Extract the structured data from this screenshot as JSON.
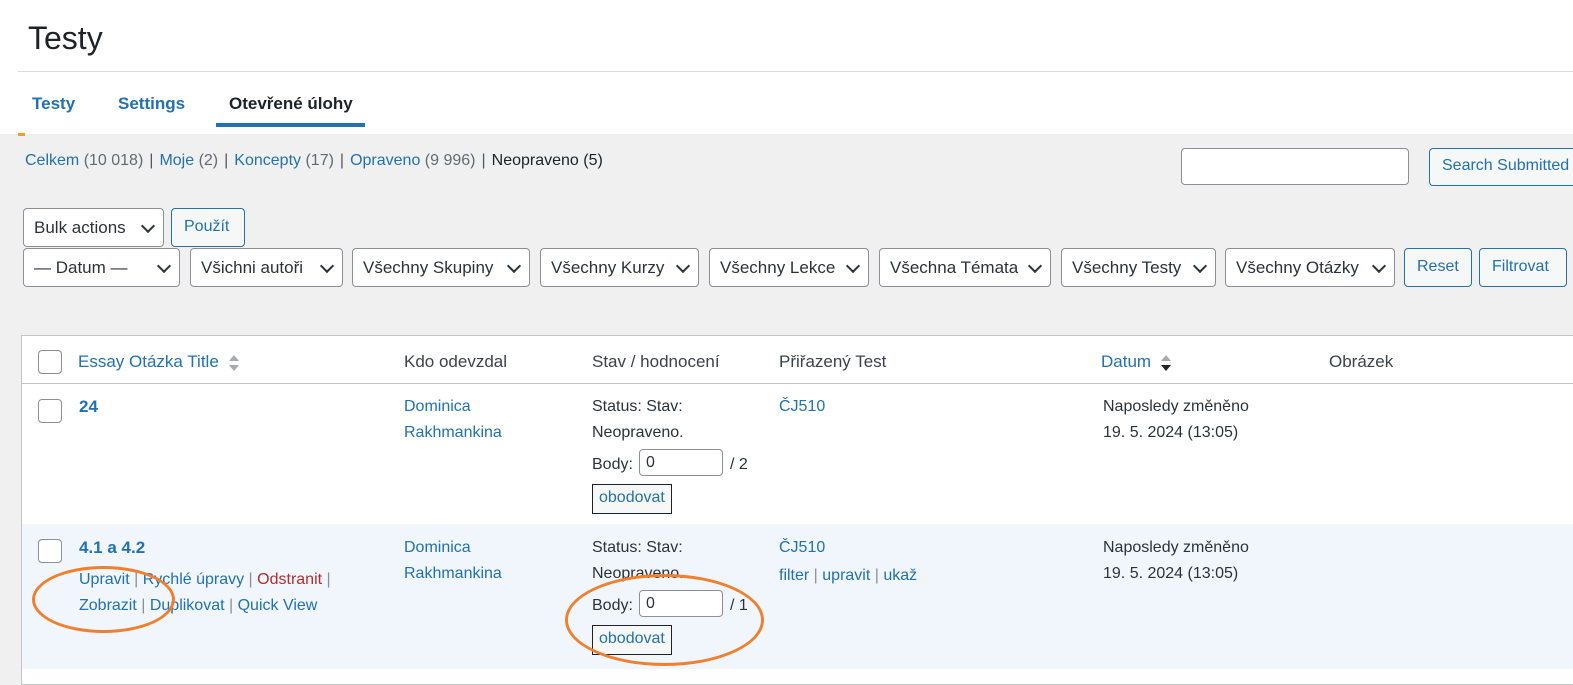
{
  "page_title": "Testy",
  "tabs": [
    "Testy",
    "Settings",
    "Otevřené úlohy"
  ],
  "views": [
    {
      "label": "Celkem",
      "count": "(10 018)"
    },
    {
      "label": "Moje",
      "count": "(2)"
    },
    {
      "label": "Koncepty",
      "count": "(17)"
    },
    {
      "label": "Opraveno",
      "count": "(9 996)"
    },
    {
      "label": "Neopraveno",
      "count": "(5)"
    }
  ],
  "search": {
    "value": "",
    "button_label": "Search Submitted"
  },
  "bulk": {
    "select_label": "Bulk actions",
    "apply_label": "Použít"
  },
  "filters": [
    "— Datum —",
    "Všichni autoři",
    "Všechny Skupiny",
    "Všechny Kurzy",
    "Všechny Lekce",
    "Všechna Témata",
    "Všechny Testy",
    "Všechny Otázky"
  ],
  "filter_buttons": {
    "reset": "Reset",
    "filter": "Filtrovat"
  },
  "columns": [
    "Essay Otázka Title",
    "Kdo odevzdal",
    "Stav / hodnocení",
    "Přiřazený Test",
    "Datum",
    "Obrázek"
  ],
  "rows": [
    {
      "title": "24",
      "author_first": "Dominica",
      "author_last": "Rakhmankina",
      "status_line1": "Status: Stav:",
      "status_line2": "Neopraveno.",
      "points_label": "Body:",
      "points_value": "0",
      "points_max": "/ 2",
      "grade_button": "obodovat",
      "test": "ČJ510",
      "date_line1": "Naposledy změněno",
      "date_line2": "19. 5. 2024 (13:05)"
    },
    {
      "title": "4.1 a 4.2",
      "author_first": "Dominica",
      "author_last": "Rakhmankina",
      "status_line1": "Status: Stav:",
      "status_line2": "Neopraveno.",
      "points_label": "Body:",
      "points_value": "0",
      "points_max": "/ 1",
      "grade_button": "obodovat",
      "test": "ČJ510",
      "test_actions": [
        "filter",
        "upravit",
        "ukaž"
      ],
      "date_line1": "Naposledy změněno",
      "date_line2": "19. 5. 2024 (13:05)",
      "row_actions_1": [
        "Upravit",
        "Rychlé úpravy",
        "Odstranit"
      ],
      "row_actions_2": [
        "Zobrazit",
        "Duplikovat",
        "Quick View"
      ]
    }
  ],
  "colors": {
    "link": "#2271b1",
    "delete": "#b32d2e",
    "annotation": "#f08030",
    "bg": "#f0f0f1"
  }
}
